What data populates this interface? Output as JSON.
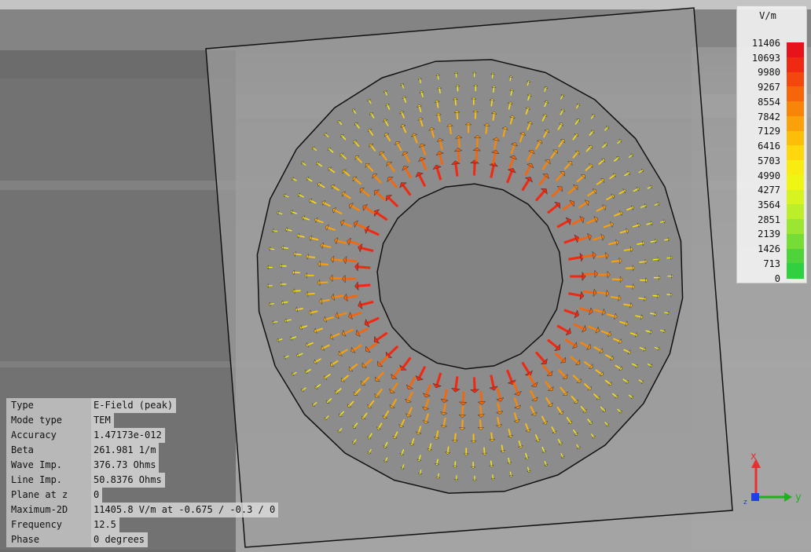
{
  "legend": {
    "unit": "V/m",
    "labels": [
      "11406",
      "10693",
      "9980",
      "9267",
      "8554",
      "7842",
      "7129",
      "6416",
      "5703",
      "4990",
      "4277",
      "3564",
      "2851",
      "2139",
      "1426",
      "713",
      "0"
    ],
    "colors": [
      "#e8121a",
      "#f02a12",
      "#f4470e",
      "#f6650a",
      "#f88408",
      "#fba20a",
      "#fdbe0a",
      "#fed80c",
      "#f8ec10",
      "#f0f614",
      "#d8f420",
      "#bdee2a",
      "#9ce632",
      "#76dc36",
      "#4ed43a",
      "#30d040"
    ]
  },
  "info": {
    "rows": [
      {
        "key": "Type",
        "value": "E-Field (peak)"
      },
      {
        "key": "Mode type",
        "value": "TEM"
      },
      {
        "key": "Accuracy",
        "value": "1.47173e-012"
      },
      {
        "key": "Beta",
        "value": "261.981 1/m"
      },
      {
        "key": "Wave Imp.",
        "value": "376.73 Ohms"
      },
      {
        "key": "Line Imp.",
        "value": "50.8376 Ohms"
      },
      {
        "key": "Plane at z",
        "value": "0"
      },
      {
        "key": "Maximum-2D",
        "value": "11405.8 V/m at -0.675 / -0.3 / 0"
      },
      {
        "key": "Frequency",
        "value": "12.5"
      },
      {
        "key": "Phase",
        "value": "0 degrees"
      }
    ]
  },
  "axes": {
    "x_label": "x",
    "y_label": "y",
    "x_color": "#e83030",
    "y_color": "#20b020",
    "z_color": "#2040e0"
  }
}
